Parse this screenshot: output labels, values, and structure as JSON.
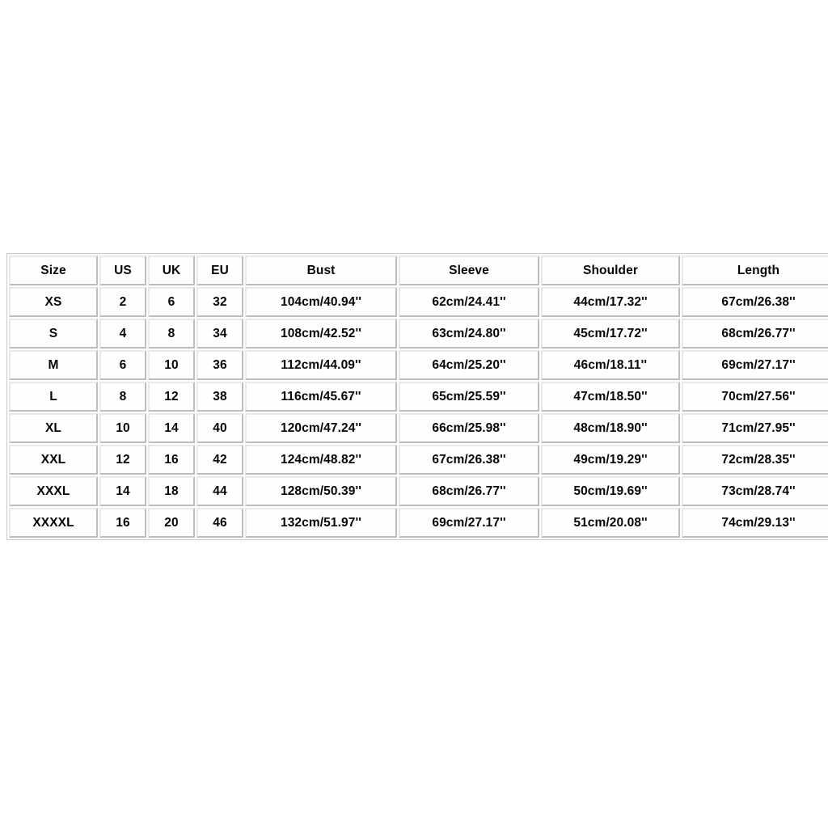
{
  "table": {
    "caption": "",
    "columns": [
      "Size",
      "US",
      "UK",
      "EU",
      "Bust",
      "Sleeve",
      "Shoulder",
      "Length"
    ],
    "rows": [
      {
        "size": "XS",
        "us": "2",
        "uk": "6",
        "eu": "32",
        "bust": "104cm/40.94''",
        "sleeve": "62cm/24.41''",
        "shoulder": "44cm/17.32''",
        "length": "67cm/26.38''"
      },
      {
        "size": "S",
        "us": "4",
        "uk": "8",
        "eu": "34",
        "bust": "108cm/42.52''",
        "sleeve": "63cm/24.80''",
        "shoulder": "45cm/17.72''",
        "length": "68cm/26.77''"
      },
      {
        "size": "M",
        "us": "6",
        "uk": "10",
        "eu": "36",
        "bust": "112cm/44.09''",
        "sleeve": "64cm/25.20''",
        "shoulder": "46cm/18.11''",
        "length": "69cm/27.17''"
      },
      {
        "size": "L",
        "us": "8",
        "uk": "12",
        "eu": "38",
        "bust": "116cm/45.67''",
        "sleeve": "65cm/25.59''",
        "shoulder": "47cm/18.50''",
        "length": "70cm/27.56''"
      },
      {
        "size": "XL",
        "us": "10",
        "uk": "14",
        "eu": "40",
        "bust": "120cm/47.24''",
        "sleeve": "66cm/25.98''",
        "shoulder": "48cm/18.90''",
        "length": "71cm/27.95''"
      },
      {
        "size": "XXL",
        "us": "12",
        "uk": "16",
        "eu": "42",
        "bust": "124cm/48.82''",
        "sleeve": "67cm/26.38''",
        "shoulder": "49cm/19.29''",
        "length": "72cm/28.35''"
      },
      {
        "size": "XXXL",
        "us": "14",
        "uk": "18",
        "eu": "44",
        "bust": "128cm/50.39''",
        "sleeve": "68cm/26.77''",
        "shoulder": "50cm/19.69''",
        "length": "73cm/28.74''"
      },
      {
        "size": "XXXXL",
        "us": "16",
        "uk": "20",
        "eu": "46",
        "bust": "132cm/51.97''",
        "sleeve": "69cm/27.17''",
        "shoulder": "51cm/20.08''",
        "length": "74cm/29.13''"
      }
    ]
  },
  "colors": {
    "background": "#ffffff",
    "text": "#050505",
    "cell_border_light": "#e9e9e9",
    "cell_border_dark": "#bdbdbd",
    "cell_fill": "#fefefe"
  }
}
